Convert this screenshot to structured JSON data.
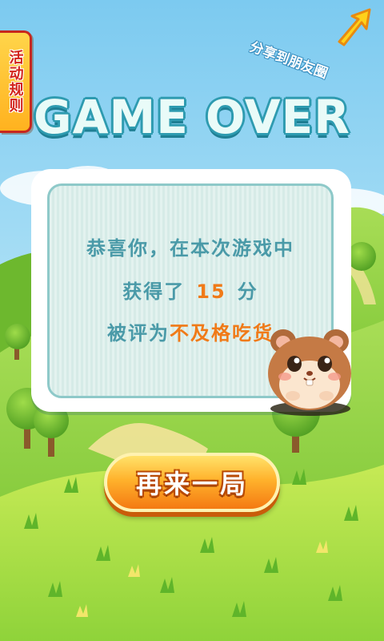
{
  "title": "GAME OVER",
  "rules_tab": {
    "label": "活动规则"
  },
  "share": {
    "label": "分享到朋友圈",
    "icon": "arrow-up-right-icon"
  },
  "result": {
    "line1": "恭喜你，在本次游戏中",
    "line2_prefix": "获得了",
    "score": "15",
    "line2_suffix": "分",
    "line3_prefix": "被评为",
    "rank": "不及格吃货"
  },
  "replay_button": {
    "label": "再来一局"
  },
  "colors": {
    "sky": "#8fd3f2",
    "grass": "#8fd33a",
    "title_fill": "#e9fbf8",
    "title_outline": "#2e9bb0",
    "message_text": "#4a9aa8",
    "highlight": "#f07a18",
    "button_orange": "#f47a12",
    "rules_red": "#d2221a"
  }
}
